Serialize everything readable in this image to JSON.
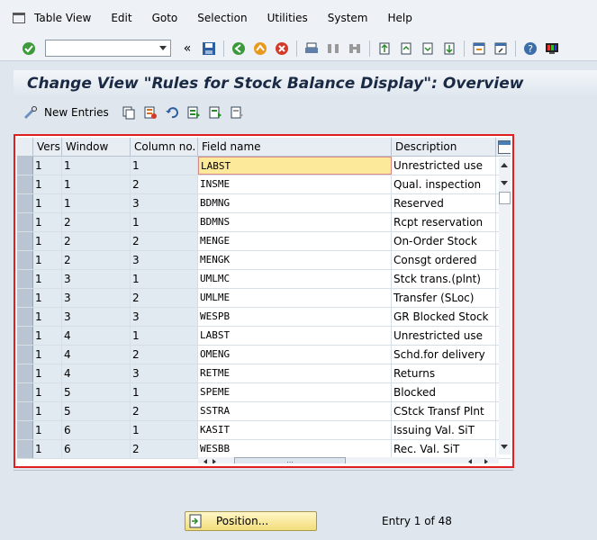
{
  "menu": [
    "Table View",
    "Edit",
    "Goto",
    "Selection",
    "Utilities",
    "System",
    "Help"
  ],
  "title": "Change View \"Rules for Stock Balance Display\": Overview",
  "apptoolbar": {
    "new_entries": "New Entries"
  },
  "grid": {
    "headers": [
      "Vers",
      "Window",
      "Column no.",
      "Field name",
      "Description"
    ],
    "rows": [
      [
        "1",
        "1",
        "1",
        "LABST",
        "Unrestricted use"
      ],
      [
        "1",
        "1",
        "2",
        "INSME",
        "Qual. inspection"
      ],
      [
        "1",
        "1",
        "3",
        "BDMNG",
        "Reserved"
      ],
      [
        "1",
        "2",
        "1",
        "BDMNS",
        "Rcpt reservation"
      ],
      [
        "1",
        "2",
        "2",
        "MENGE",
        "On-Order Stock"
      ],
      [
        "1",
        "2",
        "3",
        "MENGK",
        "Consgt ordered"
      ],
      [
        "1",
        "3",
        "1",
        "UMLMC",
        "Stck trans.(plnt)"
      ],
      [
        "1",
        "3",
        "2",
        "UMLME",
        "Transfer (SLoc)"
      ],
      [
        "1",
        "3",
        "3",
        "WESPB",
        "GR Blocked Stock"
      ],
      [
        "1",
        "4",
        "1",
        "LABST",
        "Unrestricted use"
      ],
      [
        "1",
        "4",
        "2",
        "OMENG",
        "Schd.for delivery"
      ],
      [
        "1",
        "4",
        "3",
        "RETME",
        "Returns"
      ],
      [
        "1",
        "5",
        "1",
        "SPEME",
        "Blocked"
      ],
      [
        "1",
        "5",
        "2",
        "SSTRA",
        "CStck Transf Plnt"
      ],
      [
        "1",
        "6",
        "1",
        "KASIT",
        "Issuing Val. SiT"
      ],
      [
        "1",
        "6",
        "2",
        "WESBB",
        "Rec. Val. SiT"
      ]
    ]
  },
  "position_button": "Position...",
  "entry_info": "Entry 1 of 48",
  "colors": {
    "accent_red": "#e02020",
    "active_cell": "#fde99a",
    "button_yellow": "#f2de7a"
  }
}
